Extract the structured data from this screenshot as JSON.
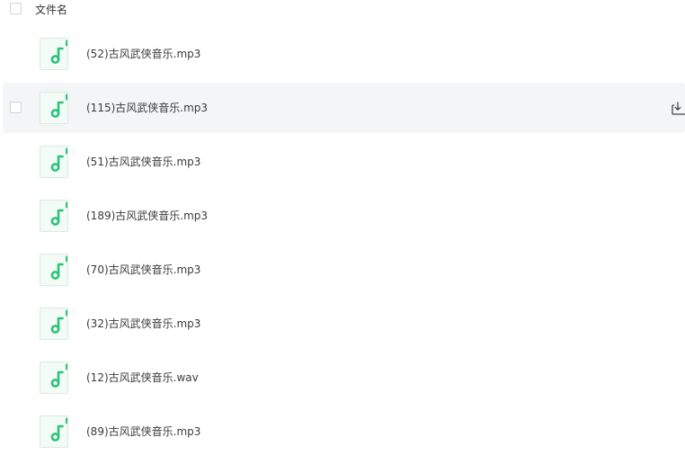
{
  "header": {
    "column_label": "文件名"
  },
  "files": [
    {
      "name": "(52)古风武侠音乐.mp3",
      "icon": "music-file-icon"
    },
    {
      "name": "(115)古风武侠音乐.mp3",
      "icon": "music-file-icon",
      "hovered": true
    },
    {
      "name": "(51)古风武侠音乐.mp3",
      "icon": "music-file-icon"
    },
    {
      "name": "(189)古风武侠音乐.mp3",
      "icon": "music-file-icon"
    },
    {
      "name": "(70)古风武侠音乐.mp3",
      "icon": "music-file-icon"
    },
    {
      "name": "(32)古风武侠音乐.mp3",
      "icon": "music-file-icon"
    },
    {
      "name": "(12)古风武侠音乐.wav",
      "icon": "music-file-icon"
    },
    {
      "name": "(89)古风武侠音乐.mp3",
      "icon": "music-file-icon"
    }
  ],
  "colors": {
    "accent_green": "#2cc37a",
    "hover_background": "#f4f5f6"
  }
}
